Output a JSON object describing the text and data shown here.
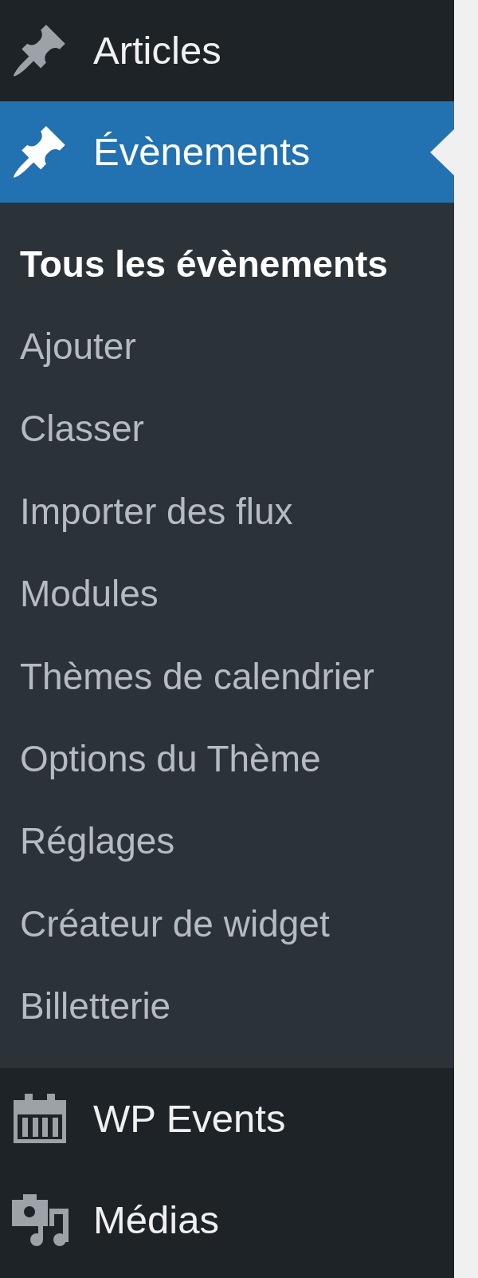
{
  "sidebar": {
    "menu": [
      {
        "label": "Articles",
        "selected": false
      },
      {
        "label": "Évènements",
        "selected": true,
        "submenu": [
          {
            "label": "Tous les évènements",
            "selected": true
          },
          {
            "label": "Ajouter",
            "selected": false
          },
          {
            "label": "Classer",
            "selected": false
          },
          {
            "label": "Importer des flux",
            "selected": false
          },
          {
            "label": "Modules",
            "selected": false
          },
          {
            "label": "Thèmes de calendrier",
            "selected": false
          },
          {
            "label": "Options du Thème",
            "selected": false
          },
          {
            "label": "Réglages",
            "selected": false
          },
          {
            "label": "Créateur de widget",
            "selected": false
          },
          {
            "label": "Billetterie",
            "selected": false
          }
        ]
      },
      {
        "label": "WP Events",
        "selected": false
      },
      {
        "label": "Médias",
        "selected": false
      }
    ]
  }
}
